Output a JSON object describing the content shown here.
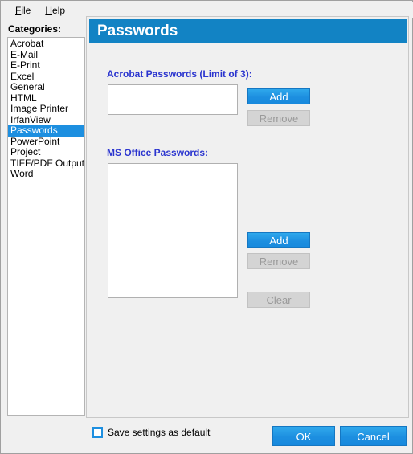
{
  "window": {
    "menu": [
      {
        "label": "File",
        "accel": "F",
        "rest": "ile"
      },
      {
        "label": "Help",
        "accel": "H",
        "rest": "elp"
      }
    ]
  },
  "sidebar": {
    "label": "Categories:",
    "selected": "Passwords",
    "items": [
      "Acrobat",
      "E-Mail",
      "E-Print",
      "Excel",
      "General",
      "HTML",
      "Image Printer",
      "IrfanView",
      "Passwords",
      "PowerPoint",
      "Project",
      "TIFF/PDF Output",
      "Word"
    ]
  },
  "panel": {
    "title": "Passwords",
    "acrobat": {
      "label": "Acrobat Passwords (Limit of 3):",
      "value": "",
      "add_label": "Add",
      "remove_label": "Remove"
    },
    "msoffice": {
      "label": "MS Office Passwords:",
      "value": "",
      "add_label": "Add",
      "remove_label": "Remove",
      "clear_label": "Clear"
    }
  },
  "footer": {
    "save_default_label": "Save settings as default",
    "save_default_checked": false,
    "ok_label": "OK",
    "cancel_label": "Cancel"
  },
  "colors": {
    "accent": "#1d8fe0",
    "header_bg": "#1283c4",
    "label_blue": "#2b35cf",
    "disabled_bg": "#d4d4d4",
    "disabled_text": "#9a9a9a"
  }
}
